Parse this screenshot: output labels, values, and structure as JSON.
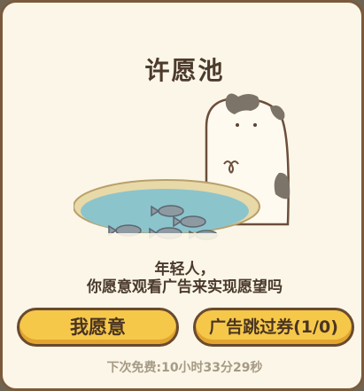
{
  "dialog": {
    "title": "许愿池",
    "message_line1": "年轻人，",
    "message_line2": "你愿意观看广告来实现愿望吗",
    "accept_label": "我愿意",
    "skip_label": "广告跳过券(1/0)",
    "timer_prefix": "下次免费:",
    "timer_value": "10小时33分29秒"
  },
  "colors": {
    "panel_bg": "#fbf6e8",
    "border": "#7b5a3c",
    "button_fill": "#f6c84a",
    "timer_text": "#a69a85",
    "water": "#8cc4cc"
  },
  "icons": [
    "cat-illustration",
    "wishing-pond-illustration",
    "fish-icon"
  ]
}
